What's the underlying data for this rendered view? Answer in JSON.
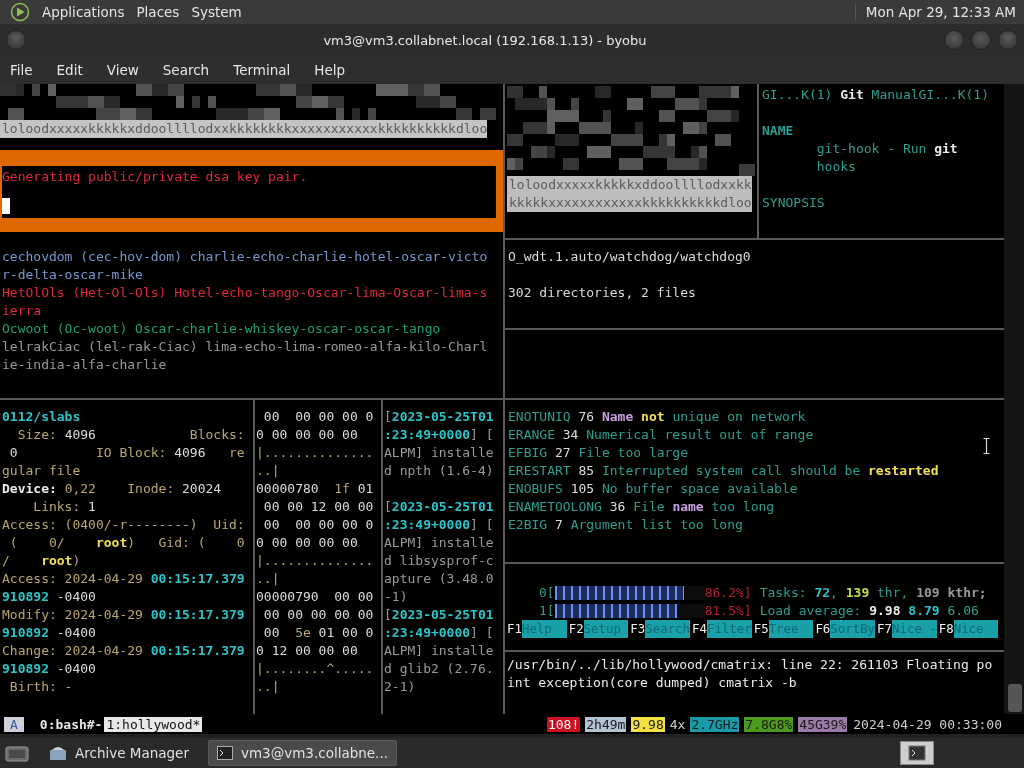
{
  "top_panel": {
    "menus": [
      "Applications",
      "Places",
      "System"
    ],
    "clock": "Mon Apr 29, 12:33 AM"
  },
  "window": {
    "title": "vm3@vm3.collabnet.local (192.168.1.13) - byobu",
    "menus": [
      "File",
      "Edit",
      "View",
      "Search",
      "Terminal",
      "Help"
    ]
  },
  "matrix_left": {
    "lines": [
      "loloodxxxxxkkkkkxddoollllodxxkkkkkkkkxxxxxxxxxxxkkkkkkkkkkdloo"
    ]
  },
  "keygen": {
    "lines": [
      "Generating public/private dsa key pair."
    ]
  },
  "matrix_middle": {
    "lines": [
      "loloodxxxxxkkkkkxddoollllodxxkk",
      "kkkkkxxxxxxxxxxxxkkkkkkkkkkdloo"
    ]
  },
  "man_page": {
    "paragraphs": [
      [
        [
          {
            "text": "GI...K(1) ",
            "kind": "teal"
          },
          {
            "text": "Git",
            "kind": "bold"
          },
          {
            "text": " ManualGI...K(1)",
            "kind": "teal"
          }
        ]
      ],
      [
        [
          {
            "text": "NAME",
            "kind": "tealbold"
          }
        ],
        [
          {
            "text": "       git-hook - Run ",
            "kind": "teal"
          },
          {
            "text": "git",
            "kind": "bold"
          }
        ],
        [
          {
            "text": "       hooks",
            "kind": "teal"
          }
        ]
      ],
      [
        [
          {
            "text": "SYNOPSIS",
            "kind": "teal"
          }
        ]
      ]
    ]
  },
  "phonetic": {
    "paragraphs": [
      [
        [
          {
            "text": "cechovdom (cec-hov-dom) charlie-echo-charlie-hotel-oscar-victo",
            "kind": "blue"
          }
        ],
        [
          {
            "text": "r-delta-oscar-mike",
            "kind": "blue"
          }
        ],
        [
          {
            "text": "HetOlOls (Het-Ol-Ols) Hotel-echo-tango-Oscar-lima-Oscar-lima-s",
            "kind": "red"
          }
        ],
        [
          {
            "text": "ierra",
            "kind": "red"
          }
        ],
        [
          {
            "text": "Ocwoot (Oc-woot) Oscar-charlie-whiskey-oscar-oscar-tango",
            "kind": "green"
          }
        ],
        [
          {
            "text": "lelrakCiac (lel-rak-Ciac) lima-echo-lima-romeo-alfa-kilo-Charl",
            "kind": "dim"
          }
        ],
        [
          {
            "text": "ie-india-alfa-charlie",
            "kind": "dim"
          }
        ]
      ]
    ]
  },
  "tree_output": {
    "paragraphs": [
      [
        [
          {
            "text": "O_wdt.1.auto/watchdog/watchdog0",
            "kind": "plain"
          }
        ]
      ],
      [
        [
          {
            "text": "302 directories, 2 files",
            "kind": "plain"
          }
        ]
      ]
    ]
  },
  "stat": {
    "paragraphs": [
      [
        [
          {
            "text": "0112/slabs",
            "kind": "cyan"
          }
        ],
        [
          {
            "text": "  Size: ",
            "kind": "label"
          },
          {
            "text": "4096",
            "kind": "plain"
          },
          {
            "text": "            Blocks:",
            "kind": "label"
          }
        ],
        [
          {
            "text": " 0",
            "kind": "plain"
          },
          {
            "text": "          IO Block: ",
            "kind": "label"
          },
          {
            "text": "4096",
            "kind": "plain"
          },
          {
            "text": "   re",
            "kind": "label"
          }
        ],
        [
          {
            "text": "gular file",
            "kind": "label"
          }
        ],
        [
          {
            "text": "Device: ",
            "kind": "bold"
          },
          {
            "text": "0,22",
            "kind": "label"
          },
          {
            "text": "    Inode: ",
            "kind": "label"
          },
          {
            "text": "20024",
            "kind": "plain"
          }
        ],
        [
          {
            "text": "    Links: ",
            "kind": "label"
          },
          {
            "text": "1",
            "kind": "plain"
          }
        ],
        [
          {
            "text": "Access: (0400/-r--------)  Uid:",
            "kind": "label"
          }
        ],
        [
          {
            "text": " (    0/    ",
            "kind": "label"
          },
          {
            "text": "root",
            "kind": "yellow"
          },
          {
            "text": ")   Gid: (    0",
            "kind": "label"
          }
        ],
        [
          {
            "text": "/    ",
            "kind": "label"
          },
          {
            "text": "root",
            "kind": "yellow"
          },
          {
            "text": ")",
            "kind": "label"
          }
        ],
        [
          {
            "text": "Access: 2024-04-29 ",
            "kind": "label"
          },
          {
            "text": "00:15:17.379",
            "kind": "cyan"
          }
        ],
        [
          {
            "text": "910892",
            "kind": "cyan"
          },
          {
            "text": " -0400",
            "kind": "plain"
          }
        ],
        [
          {
            "text": "Modify: 2024-04-29 ",
            "kind": "label"
          },
          {
            "text": "00:15:17.379",
            "kind": "cyan"
          }
        ],
        [
          {
            "text": "910892",
            "kind": "cyan"
          },
          {
            "text": " -0400",
            "kind": "plain"
          }
        ],
        [
          {
            "text": "Change: 2024-04-29 ",
            "kind": "label"
          },
          {
            "text": "00:15:17.379",
            "kind": "cyan"
          }
        ],
        [
          {
            "text": "910892",
            "kind": "cyan"
          },
          {
            "text": " -0400",
            "kind": "plain"
          }
        ],
        [
          {
            "text": " Birth: -",
            "kind": "label"
          }
        ]
      ]
    ]
  },
  "hexdump": {
    "paragraphs": [
      [
        [
          {
            "text": " 00  00 00 00 0",
            "kind": "plain"
          }
        ],
        [
          {
            "text": "0 00 00 00 00",
            "kind": "plain"
          }
        ],
        [
          {
            "text": "|..............",
            "kind": "label"
          }
        ],
        [
          {
            "text": "..|",
            "kind": "label"
          }
        ],
        [
          {
            "text": "00000780  ",
            "kind": "plain"
          },
          {
            "text": "1f",
            "kind": "label"
          },
          {
            "text": " 01",
            "kind": "plain"
          }
        ],
        [
          {
            "text": " 00 00 12 00 00",
            "kind": "plain"
          }
        ],
        [
          {
            "text": " 00  00 00 00 0",
            "kind": "plain"
          }
        ],
        [
          {
            "text": "0 00 00 00 00",
            "kind": "plain"
          }
        ],
        [
          {
            "text": "|..............",
            "kind": "label"
          }
        ],
        [
          {
            "text": "..|",
            "kind": "label"
          }
        ],
        [
          {
            "text": "00000790  00 00",
            "kind": "plain"
          }
        ],
        [
          {
            "text": " 00 00 00 00 00",
            "kind": "plain"
          }
        ],
        [
          {
            "text": " 00  ",
            "kind": "plain"
          },
          {
            "text": "5e",
            "kind": "label"
          },
          {
            "text": " 01 00 0",
            "kind": "plain"
          }
        ],
        [
          {
            "text": "0 12 00 00 00",
            "kind": "plain"
          }
        ],
        [
          {
            "text": "|........^.....",
            "kind": "label"
          }
        ],
        [
          {
            "text": "..|",
            "kind": "label"
          }
        ]
      ]
    ]
  },
  "pacman_log": {
    "paragraphs": [
      [
        [
          {
            "text": "[",
            "kind": "dim"
          },
          {
            "text": "2023-05-25T01",
            "kind": "cyan"
          }
        ],
        [
          {
            "text": ":23:49+0000",
            "kind": "cyan"
          },
          {
            "text": "] [",
            "kind": "dim"
          }
        ],
        [
          {
            "text": "ALPM] installe",
            "kind": "dim"
          }
        ],
        [
          {
            "text": "d npth (1.6-4)",
            "kind": "dim"
          }
        ]
      ],
      [
        [
          {
            "text": "[",
            "kind": "dim"
          },
          {
            "text": "2023-05-25T01",
            "kind": "cyan"
          }
        ],
        [
          {
            "text": ":23:49+0000",
            "kind": "cyan"
          },
          {
            "text": "] [",
            "kind": "dim"
          }
        ],
        [
          {
            "text": "ALPM] installe",
            "kind": "dim"
          }
        ],
        [
          {
            "text": "d libsysprof-c",
            "kind": "dim"
          }
        ],
        [
          {
            "text": "apture (3.48.0",
            "kind": "dim"
          }
        ],
        [
          {
            "text": "-1)",
            "kind": "dim"
          }
        ],
        [
          {
            "text": "[",
            "kind": "dim"
          },
          {
            "text": "2023-05-25T01",
            "kind": "cyan"
          }
        ],
        [
          {
            "text": ":23:49+0000",
            "kind": "cyan"
          },
          {
            "text": "] [",
            "kind": "dim"
          }
        ],
        [
          {
            "text": "ALPM] installe",
            "kind": "dim"
          }
        ],
        [
          {
            "text": "d glib2 (2.76.",
            "kind": "dim"
          }
        ],
        [
          {
            "text": "2-1)",
            "kind": "dim"
          }
        ]
      ]
    ]
  },
  "errno": {
    "paragraphs": [
      [
        [
          {
            "text": "ENOTUNIQ ",
            "kind": "teal"
          },
          {
            "text": "76 ",
            "kind": "plain"
          },
          {
            "text": "Name ",
            "kind": "purple"
          },
          {
            "text": "not",
            "kind": "yellow"
          },
          {
            "text": " unique on network",
            "kind": "teal"
          }
        ],
        [
          {
            "text": "ERANGE ",
            "kind": "teal"
          },
          {
            "text": "34 ",
            "kind": "plain"
          },
          {
            "text": "Numerical result out of range",
            "kind": "teal"
          }
        ],
        [
          {
            "text": "EFBIG ",
            "kind": "teal"
          },
          {
            "text": "27 ",
            "kind": "plain"
          },
          {
            "text": "File too large",
            "kind": "teal"
          }
        ],
        [
          {
            "text": "ERESTART ",
            "kind": "teal"
          },
          {
            "text": "85 ",
            "kind": "plain"
          },
          {
            "text": "Interrupted system call should be ",
            "kind": "teal"
          },
          {
            "text": "restarted",
            "kind": "yellow"
          }
        ],
        [
          {
            "text": "ENOBUFS ",
            "kind": "teal"
          },
          {
            "text": "105 ",
            "kind": "plain"
          },
          {
            "text": "No buffer space available",
            "kind": "teal"
          }
        ],
        [
          {
            "text": "ENAMETOOLONG ",
            "kind": "teal"
          },
          {
            "text": "36 ",
            "kind": "plain"
          },
          {
            "text": "File ",
            "kind": "teal"
          },
          {
            "text": "name",
            "kind": "purple"
          },
          {
            "text": " too long",
            "kind": "teal"
          }
        ],
        [
          {
            "text": "E2BIG ",
            "kind": "teal"
          },
          {
            "text": "7 ",
            "kind": "plain"
          },
          {
            "text": "Argument list too long",
            "kind": "teal"
          }
        ]
      ]
    ]
  },
  "htop": {
    "cpus": [
      {
        "label": "0[",
        "level": 0.862,
        "reading": "86.2%]",
        "info": [
          {
            "text": "Tasks: ",
            "kind": "teal"
          },
          {
            "text": "72",
            "kind": "cyan"
          },
          {
            "text": ", ",
            "kind": "teal"
          },
          {
            "text": "139",
            "kind": "lime"
          },
          {
            "text": " thr, ",
            "kind": "teal"
          },
          {
            "text": "109 kthr;",
            "kind": "dimbold"
          }
        ]
      },
      {
        "label": "1[",
        "level": 0.815,
        "reading": "81.5%]",
        "info": [
          {
            "text": "Load average: ",
            "kind": "teal"
          },
          {
            "text": "9.98 ",
            "kind": "bold"
          },
          {
            "text": "8.79",
            "kind": "cyan"
          },
          {
            "text": " 6.06",
            "kind": "teal"
          }
        ]
      }
    ],
    "function_keys": [
      {
        "key": "F1",
        "label": "Help"
      },
      {
        "key": "F2",
        "label": "Setup"
      },
      {
        "key": "F3",
        "label": "Search"
      },
      {
        "key": "F4",
        "label": "Filter"
      },
      {
        "key": "F5",
        "label": "Tree"
      },
      {
        "key": "F6",
        "label": "SortBy"
      },
      {
        "key": "F7",
        "label": "Nice -"
      },
      {
        "key": "F8",
        "label": "Nice"
      }
    ]
  },
  "crash_message": {
    "lines": [
      "/usr/bin/../lib/hollywood/cmatrix: line 22: 261103 Floating po",
      "int exception(core dumped) cmatrix -b"
    ]
  },
  "tmux_status": {
    "session": "A",
    "windows": [
      {
        "label": "0:bash#-",
        "selected": false
      },
      {
        "label": "1:hollywood*",
        "selected": true
      }
    ],
    "indicators": [
      {
        "text": "108!",
        "kind": "badge",
        "color": "#cc1020"
      },
      {
        "text": "2h49m",
        "kind": "badge",
        "color": "#b4c4d4"
      },
      {
        "text": "9.98",
        "kind": "badge",
        "color": "#f0e040"
      },
      {
        "text": "4x",
        "kind": "plain"
      },
      {
        "text": "2.7GHz",
        "kind": "badge",
        "color": "#1a9aa8"
      },
      {
        "text": "7.8G8%",
        "kind": "badge",
        "color": "#4e9a1c"
      },
      {
        "text": "45G39%",
        "kind": "badge",
        "color": "#9c7aa8"
      }
    ],
    "clock": "2024-04-29 00:33:00"
  },
  "taskbar": {
    "items": [
      {
        "label": "Archive Manager",
        "selected": false
      },
      {
        "label": "vm3@vm3.collabne...",
        "selected": true
      }
    ]
  }
}
